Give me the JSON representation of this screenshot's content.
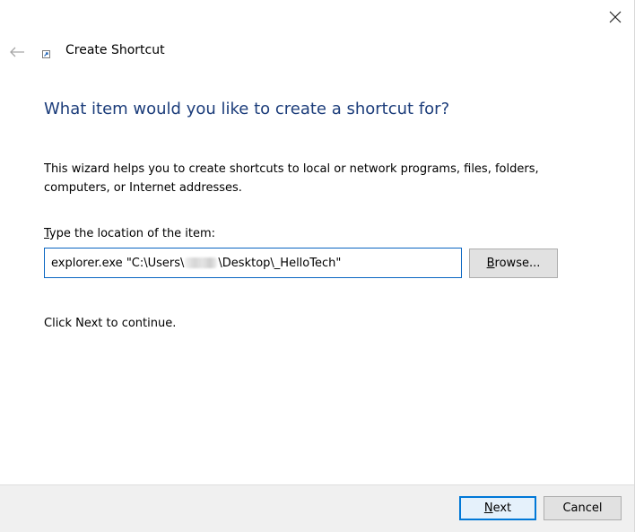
{
  "window": {
    "title": "Create Shortcut",
    "close_icon": "close-icon",
    "back_icon": "back-arrow-icon",
    "title_icon": "shortcut-icon"
  },
  "content": {
    "heading": "What item would you like to create a shortcut for?",
    "description": "This wizard helps you to create shortcuts to local or network programs, files, folders, computers, or Internet addresses.",
    "location_label_mnemonic": "T",
    "location_label_rest": "ype the location of the item:",
    "location_value_before": "explorer.exe \"C:\\Users\\",
    "location_value_after": "\\Desktop\\_HelloTech\"",
    "browse_mnemonic": "B",
    "browse_rest": "rowse...",
    "continue_text": "Click Next to continue."
  },
  "footer": {
    "next_mnemonic": "N",
    "next_rest": "ext",
    "cancel_label": "Cancel"
  },
  "colors": {
    "heading": "#1b3c7a",
    "input_border": "#0a66c2",
    "default_button_border": "#0078d7",
    "footer_bg": "#f0f0f0"
  }
}
